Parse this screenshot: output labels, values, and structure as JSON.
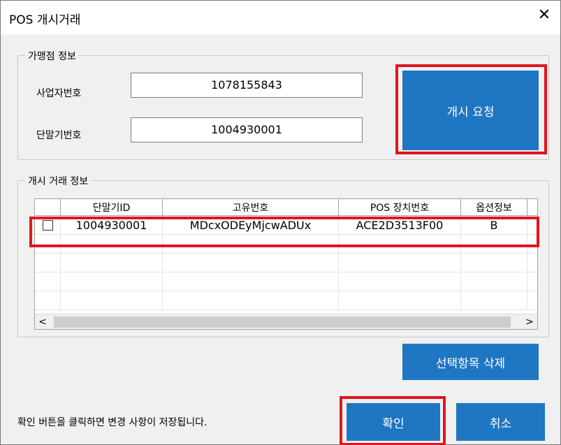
{
  "window": {
    "title": "POS 개시거래",
    "close_symbol": "✕"
  },
  "merchant_group": {
    "legend": "가맹점 정보",
    "business_number_label": "사업자번호",
    "business_number_value": "1078155843",
    "terminal_number_label": "단말기번호",
    "terminal_number_value": "1004930001",
    "open_request_button": "개시 요청"
  },
  "transaction_group": {
    "legend": "개시 거래 정보",
    "columns": [
      "",
      "단말기ID",
      "고유번호",
      "POS 장치번호",
      "옵션정보"
    ],
    "rows": [
      {
        "checked": false,
        "terminal_id": "1004930001",
        "unique_number": "MDcxODEyMjcwADUx",
        "pos_device_number": "ACE2D3513F00",
        "option_info": "B"
      }
    ],
    "scroll_left": "<",
    "scroll_right": ">",
    "delete_selected_button": "선택항목 삭제"
  },
  "footer": {
    "status_text": "확인 버튼을 클릭하면 변경 사항이 저장됩니다.",
    "confirm_button": "확인",
    "cancel_button": "취소"
  },
  "colors": {
    "button_blue": "#1f76c2",
    "highlight_red": "#e0161e"
  }
}
